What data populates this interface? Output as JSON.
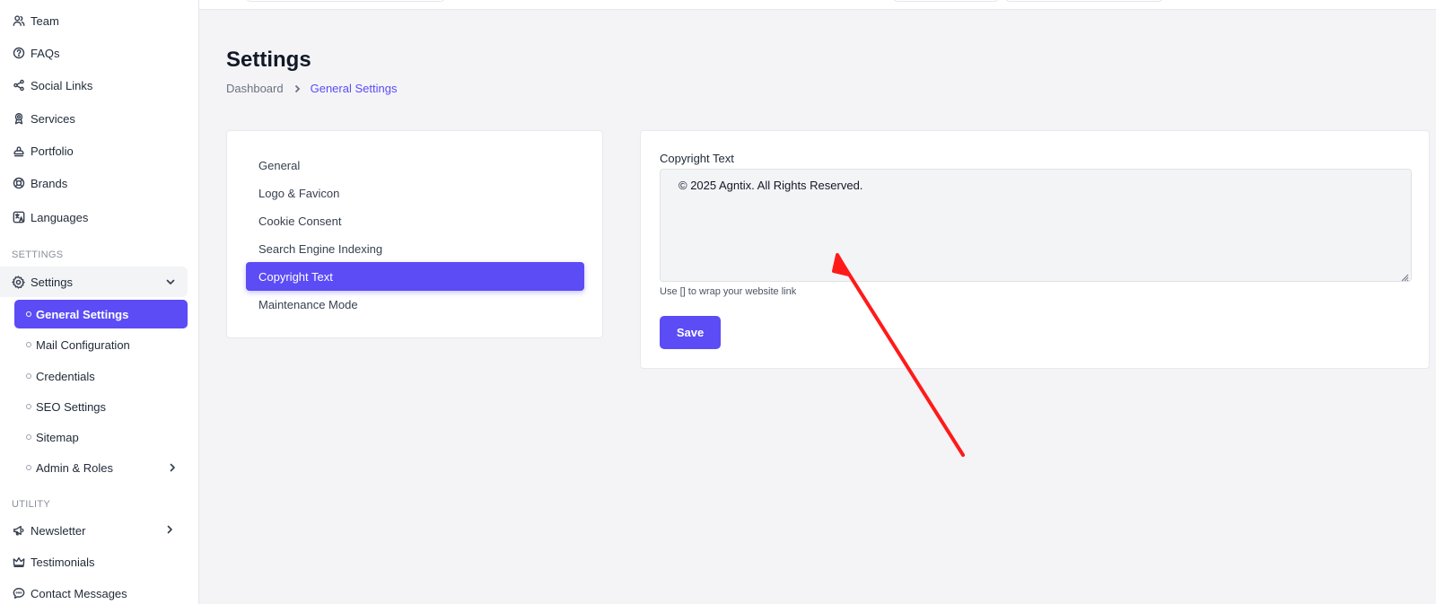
{
  "sidebar": {
    "items": [
      {
        "label": "Team",
        "icon": "users-icon"
      },
      {
        "label": "FAQs",
        "icon": "question-circle-icon"
      },
      {
        "label": "Social Links",
        "icon": "share-icon"
      },
      {
        "label": "Services",
        "icon": "award-icon"
      },
      {
        "label": "Portfolio",
        "icon": "stamp-icon"
      },
      {
        "label": "Brands",
        "icon": "lifebuoy-icon"
      },
      {
        "label": "Languages",
        "icon": "translate-icon"
      }
    ],
    "section_settings": "SETTINGS",
    "settings_group": {
      "label": "Settings",
      "icon": "gear-icon",
      "children": [
        {
          "label": "General Settings",
          "active": true
        },
        {
          "label": "Mail Configuration"
        },
        {
          "label": "Credentials"
        },
        {
          "label": "SEO Settings"
        },
        {
          "label": "Sitemap"
        },
        {
          "label": "Admin & Roles",
          "has_children": true
        }
      ]
    },
    "section_utility": "UTILITY",
    "utility_items": [
      {
        "label": "Newsletter",
        "icon": "megaphone-icon",
        "has_children": true
      },
      {
        "label": "Testimonials",
        "icon": "crown-icon"
      },
      {
        "label": "Contact Messages",
        "icon": "chat-icon"
      }
    ]
  },
  "header": {
    "title": "Settings",
    "breadcrumb": {
      "root": "Dashboard",
      "current": "General Settings"
    }
  },
  "settings_tabs": [
    {
      "label": "General"
    },
    {
      "label": "Logo & Favicon"
    },
    {
      "label": "Cookie Consent"
    },
    {
      "label": "Search Engine Indexing"
    },
    {
      "label": "Copyright Text",
      "active": true
    },
    {
      "label": "Maintenance Mode"
    }
  ],
  "form": {
    "field_label": "Copyright Text",
    "field_value": "© 2025 Agntix. All Rights Reserved.",
    "help_text": "Use [] to wrap your website link",
    "save_label": "Save"
  },
  "colors": {
    "accent": "#5b4cf5",
    "annotation_arrow": "#ff1a1a"
  }
}
